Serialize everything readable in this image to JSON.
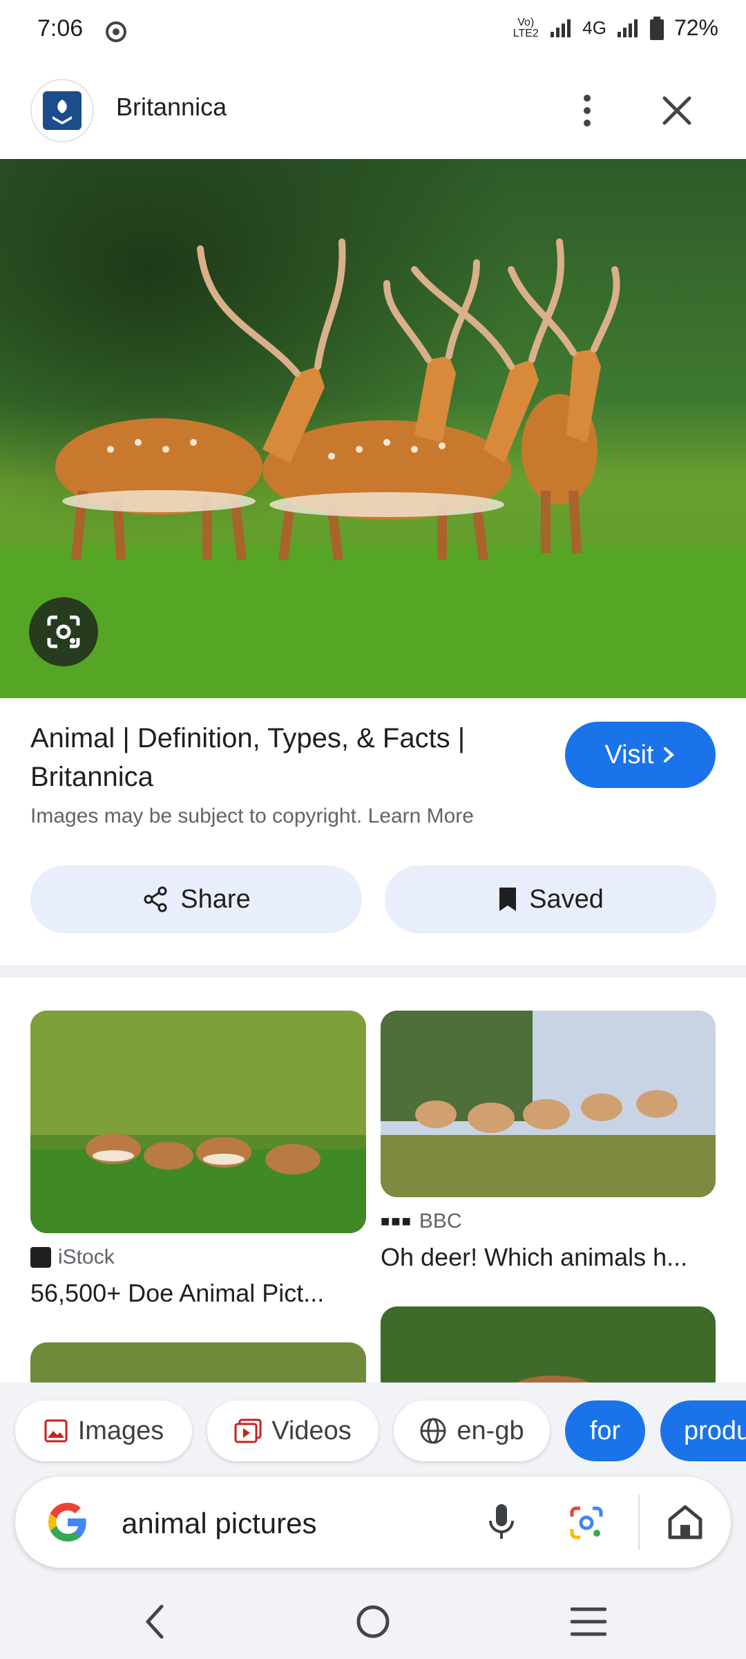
{
  "status_bar": {
    "time": "7:06",
    "network": "4G",
    "volte": "Vo) LTE2",
    "battery": "72%"
  },
  "header": {
    "site_name": "Britannica"
  },
  "result": {
    "title": "Animal | Definition, Types, & Facts | Britannica",
    "visit_label": "Visit",
    "copyright": "Images may be subject to copyright. Learn More",
    "share_label": "Share",
    "saved_label": "Saved"
  },
  "related": [
    {
      "source": "iStock",
      "title": "56,500+ Doe Animal Pict..."
    },
    {
      "source": "BBC",
      "title": "Oh deer! Which animals h..."
    }
  ],
  "chips": {
    "images": "Images",
    "videos": "Videos",
    "language": "en-gb",
    "for": "for",
    "produ": "produ"
  },
  "search": {
    "query": "animal pictures"
  },
  "colors": {
    "accent": "#1a73e8",
    "pill_bg": "#e8eefb"
  }
}
